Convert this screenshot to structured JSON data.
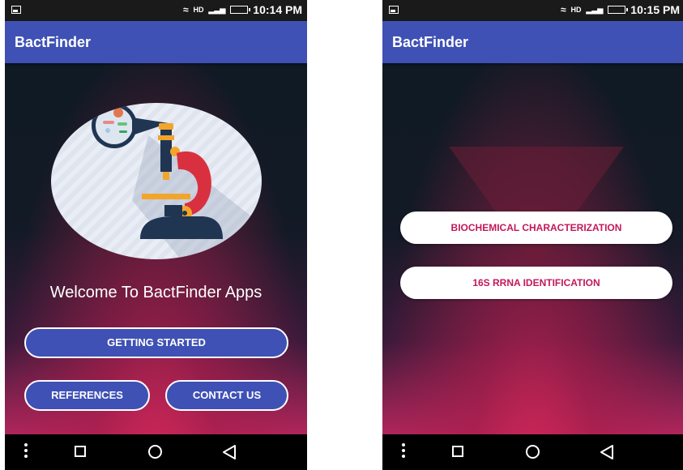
{
  "left_screen": {
    "status_time": "10:14 PM",
    "status_network": "HD",
    "app_title": "BactFinder",
    "welcome_text": "Welcome To BactFinder Apps",
    "buttons": {
      "getting_started": "GETTING STARTED",
      "references": "REFERENCES",
      "contact_us": "CONTACT US"
    }
  },
  "right_screen": {
    "status_time": "10:15 PM",
    "status_network": "HD",
    "app_title": "BactFinder",
    "buttons": {
      "biochemical": "BIOCHEMICAL CHARACTERIZATION",
      "rrna": "16S RRNA IDENTIFICATION"
    }
  },
  "colors": {
    "appbar": "#3f51b5",
    "accent_text": "#c2185b",
    "bottom_gradient": "#d6285a"
  },
  "icons": [
    "image-icon",
    "wifi-icon",
    "signal-icon",
    "battery-icon",
    "menu-dots-icon",
    "recent-apps-icon",
    "home-icon",
    "back-icon",
    "microscope-illustration"
  ]
}
